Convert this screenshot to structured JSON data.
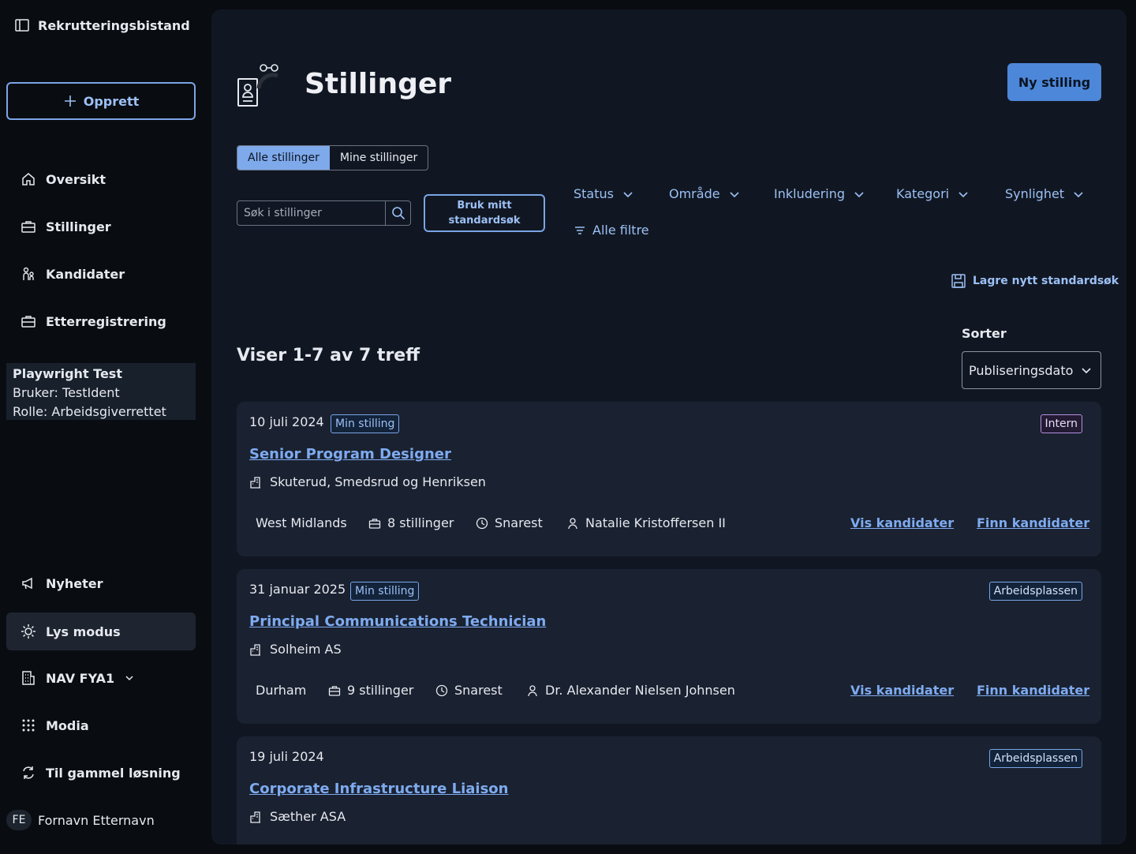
{
  "app": {
    "title": "Rekrutteringsbistand"
  },
  "sidebar": {
    "create_label": "Opprett",
    "items": [
      {
        "label": "Oversikt",
        "icon": "home-icon"
      },
      {
        "label": "Stillinger",
        "icon": "briefcase-icon"
      },
      {
        "label": "Kandidater",
        "icon": "people-icon"
      },
      {
        "label": "Etterregistrering",
        "icon": "briefcase-icon"
      }
    ],
    "user_box": {
      "name": "Playwright Test",
      "user": "Bruker: TestIdent",
      "role": "Rolle: Arbeidsgiverrettet"
    },
    "bottom_items": [
      {
        "label": "Nyheter",
        "icon": "megaphone-icon"
      },
      {
        "label": "Lys modus",
        "icon": "sun-icon"
      },
      {
        "label": "NAV FYA1",
        "icon": "building-icon"
      },
      {
        "label": "Modia",
        "icon": "grid-icon"
      },
      {
        "label": "Til gammel løsning",
        "icon": "swap-icon"
      }
    ],
    "footer": {
      "initials": "FE",
      "name": "Fornavn Etternavn"
    }
  },
  "header": {
    "title": "Stillinger",
    "new_button": "Ny stilling"
  },
  "tabs": {
    "all": "Alle stillinger",
    "mine": "Mine stillinger"
  },
  "search": {
    "placeholder": "Søk i stillinger"
  },
  "standard_search": {
    "line1": "Bruk mitt",
    "line2": "standardsøk"
  },
  "filters": [
    "Status",
    "Område",
    "Inkludering",
    "Kategori",
    "Synlighet"
  ],
  "all_filters": "Alle filtre",
  "save_standard": "Lagre nytt standardsøk",
  "results": {
    "count_text": "Viser 1-7 av 7 treff"
  },
  "sort": {
    "label": "Sorter",
    "value": "Publiseringsdato"
  },
  "cards": [
    {
      "date": "10 juli 2024",
      "tag": "Min stilling",
      "visibility": "Intern",
      "title": "Senior Program Designer",
      "company": "Skuterud, Smedsrud og Henriksen",
      "location": "West Midlands",
      "positions": "8 stillinger",
      "deadline": "Snarest",
      "contact": "Natalie Kristoffersen II",
      "show_candidates": "Vis kandidater",
      "find_candidates": "Finn kandidater"
    },
    {
      "date": "31 januar 2025",
      "tag": "Min stilling",
      "visibility": "Arbeidsplassen",
      "title": "Principal Communications Technician",
      "company": "Solheim AS",
      "location": "Durham",
      "positions": "9 stillinger",
      "deadline": "Snarest",
      "contact": "Dr. Alexander Nielsen Johnsen",
      "show_candidates": "Vis kandidater",
      "find_candidates": "Finn kandidater"
    },
    {
      "date": "19 juli 2024",
      "tag": "",
      "visibility": "Arbeidsplassen",
      "title": "Corporate Infrastructure Liaison",
      "company": "Sæther ASA"
    }
  ]
}
